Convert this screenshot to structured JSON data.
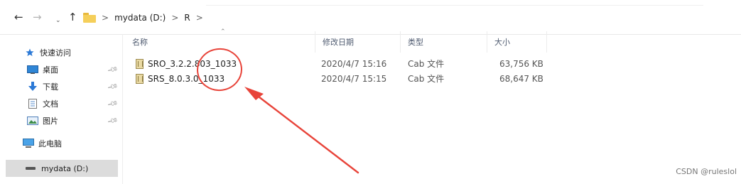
{
  "nav": {
    "back": "←",
    "forward": "→",
    "recent": "⌄",
    "up": "↑"
  },
  "breadcrumb": [
    "mydata (D:)",
    "R"
  ],
  "breadcrumb_sep": ">",
  "sidebar": {
    "quick_access": "快速访问",
    "items": [
      {
        "label": "桌面",
        "icon": "desktop-icon"
      },
      {
        "label": "下载",
        "icon": "download-icon"
      },
      {
        "label": "文档",
        "icon": "document-icon"
      },
      {
        "label": "图片",
        "icon": "pictures-icon"
      }
    ],
    "this_pc": "此电脑",
    "drive": "mydata (D:)"
  },
  "columns": {
    "name": "名称",
    "date": "修改日期",
    "type": "类型",
    "size": "大小"
  },
  "files": [
    {
      "name": "SRO_3.2.2.803_1033",
      "date": "2020/4/7 15:16",
      "type": "Cab 文件",
      "size": "63,756 KB"
    },
    {
      "name": "SRS_8.0.3.0_1033",
      "date": "2020/4/7 15:15",
      "type": "Cab 文件",
      "size": "68,647 KB"
    }
  ],
  "colors": {
    "annotation": "#e8443a",
    "selected_drive_bg": "#dcdcdc",
    "header_text": "#4f5b70"
  },
  "watermark": "CSDN @ruleslol"
}
